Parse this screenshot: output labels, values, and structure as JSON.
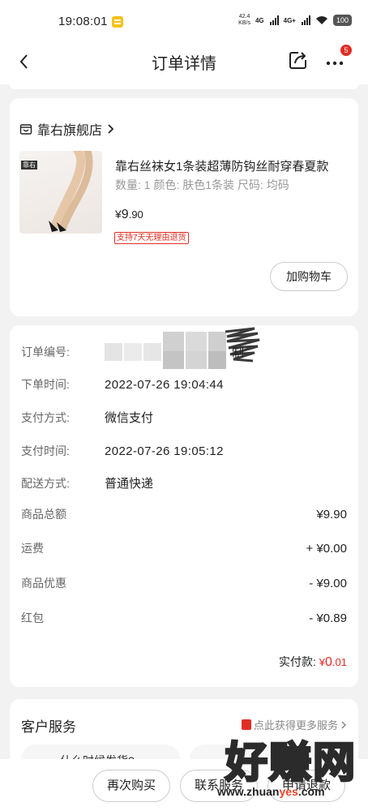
{
  "status_bar": {
    "time": "19:08:01",
    "net_speed_value": "42.4",
    "net_speed_unit": "KB/s",
    "sim1": "4G",
    "sim2": "4G+",
    "battery": "100"
  },
  "nav": {
    "title": "订单详情",
    "badge_count": "5"
  },
  "shop": {
    "name": "靠右旗舰店",
    "product": {
      "image_tag": "靠右",
      "title": "靠右丝袜女1条装超薄防钩丝耐穿春夏款",
      "spec": "数量: 1  颜色: 肤色1条装  尺码: 均码",
      "price_symbol": "¥",
      "price_int": "9",
      "price_dec": ".90",
      "return_badge": "支持7天无理由退货"
    },
    "add_cart_label": "加购物车"
  },
  "order_info": {
    "order_no_label": "订单编号:",
    "order_no_suffix": "制",
    "order_time_label": "下单时间:",
    "order_time": "2022-07-26 19:04:44",
    "pay_method_label": "支付方式:",
    "pay_method": "微信支付",
    "pay_time_label": "支付时间:",
    "pay_time": "2022-07-26 19:05:12",
    "delivery_label": "配送方式:",
    "delivery": "普通快递",
    "amounts": [
      {
        "label": "商品总额",
        "value": "¥9.90"
      },
      {
        "label": "运费",
        "value": "+ ¥0.00"
      },
      {
        "label": "商品优惠",
        "value": "- ¥9.00"
      },
      {
        "label": "红包",
        "value": "- ¥0.89"
      }
    ],
    "paid_label": "实付款:",
    "paid_symbol": "¥",
    "paid_int": "0",
    "paid_dec": ".01"
  },
  "service": {
    "title": "客户服务",
    "link": "点此获得更多服务",
    "pill_text": "什么时候发货?"
  },
  "bottom": {
    "rebuy": "再次购买",
    "contact": "联系服务",
    "refund": "申请退款"
  },
  "watermark": {
    "text": "好赚网",
    "url_prefix": "www.zhuan",
    "url_red": "yes",
    "url_suffix": ".com"
  },
  "colors": {
    "accent": "#e02e24",
    "background": "#f2f2f2",
    "card": "#ffffff"
  }
}
